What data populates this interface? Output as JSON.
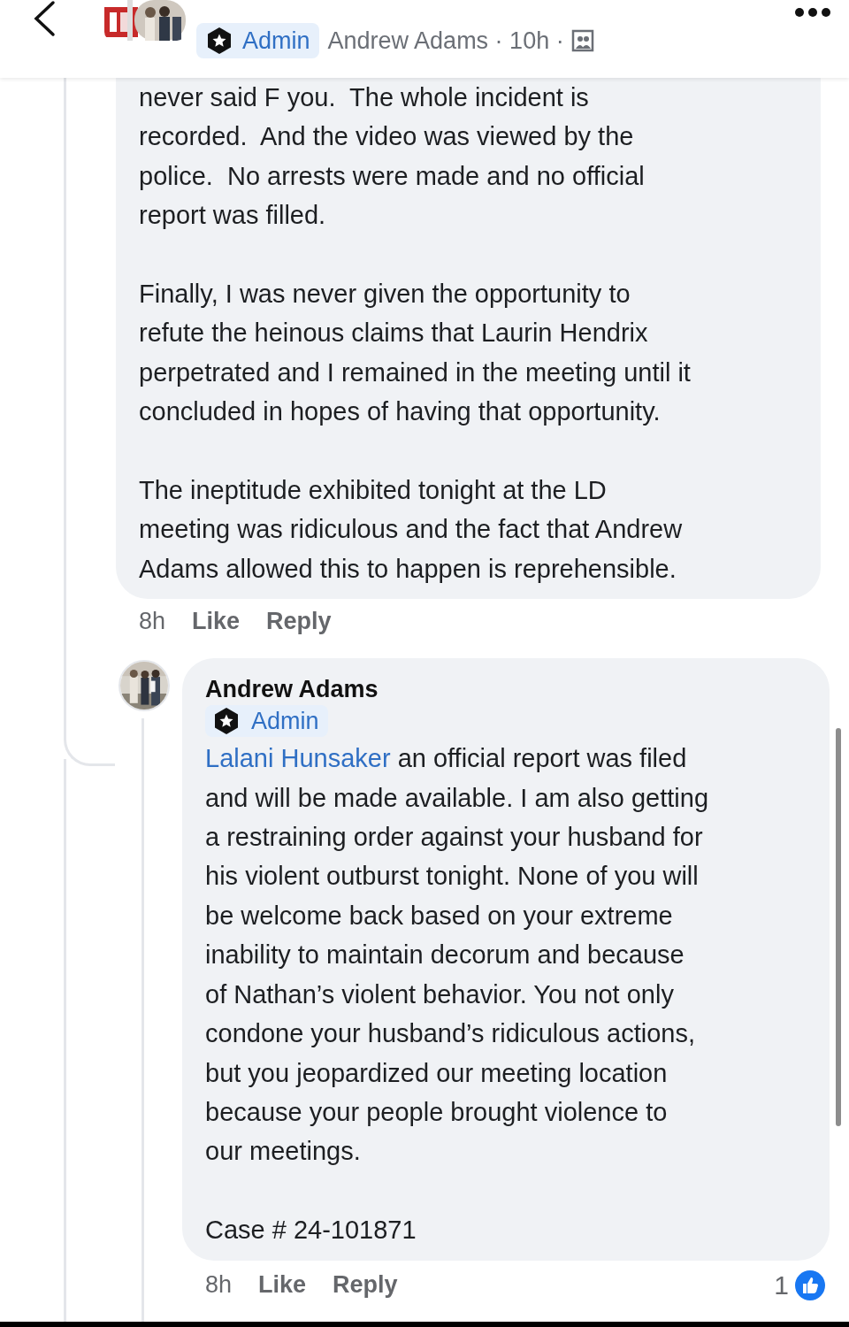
{
  "header": {
    "badge": "Admin",
    "byline": "Andrew Adams · 10h ·"
  },
  "comments": [
    {
      "kind": "continued",
      "paragraphs": [
        "never said F you.  The whole incident is\nrecorded.  And the video was viewed by the\npolice.  No arrests were made and no official\nreport was filled.",
        "Finally, I was never given the opportunity to\nrefute the heinous claims that Laurin Hendrix\nperpetrated and I remained in the meeting until it\nconcluded in hopes of having that opportunity.",
        "The ineptitude exhibited tonight at the LD\nmeeting was ridiculous and the fact that Andrew\nAdams allowed this to happen is reprehensible."
      ],
      "time": "8h",
      "actions": [
        "Like",
        "Reply"
      ]
    },
    {
      "kind": "reply",
      "author": "Andrew Adams",
      "badge": "Admin",
      "mention": "Lalani Hunsaker",
      "paragraphs": [
        " an official report was filed\nand will be made available. I am also getting\na restraining order against your husband for\nhis violent outburst tonight. None of you will\nbe welcome back based on your extreme\ninability to maintain decorum and because\nof Nathan’s violent behavior. You not only\ncondone your husband’s ridiculous actions,\nbut you jeopardized our meeting location\nbecause your people brought violence to\nour meetings.",
        "Case # 24-101871"
      ],
      "time": "8h",
      "actions": [
        "Like",
        "Reply"
      ],
      "reaction_count": "1"
    }
  ]
}
